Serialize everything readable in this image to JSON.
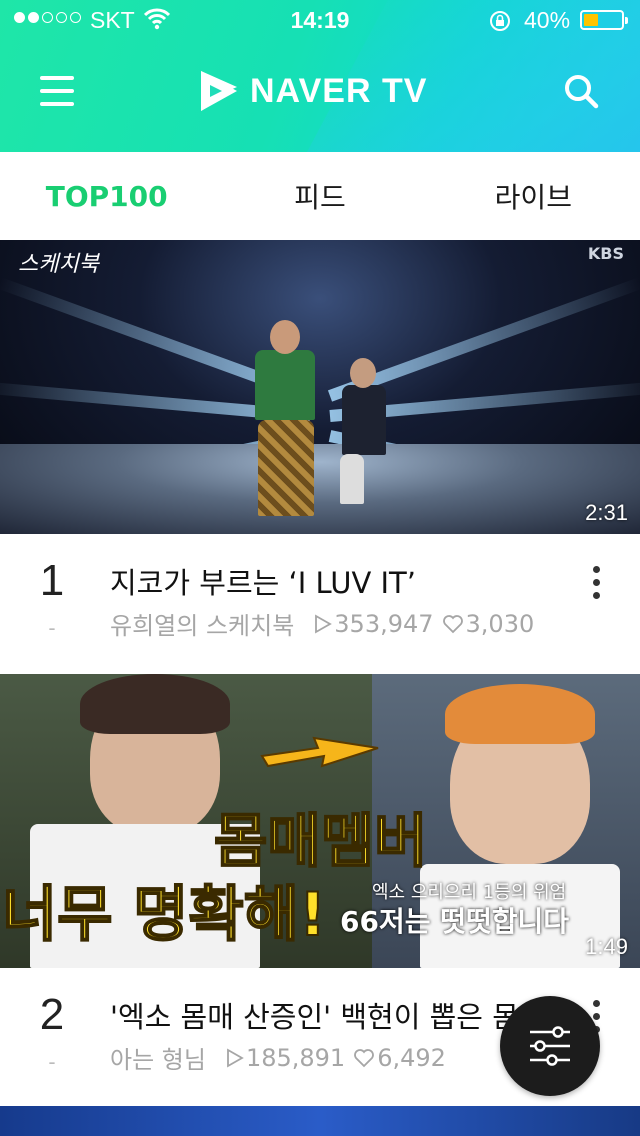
{
  "status_bar": {
    "carrier": "SKT",
    "time": "14:19",
    "battery": "40%",
    "battery_level": 0.4
  },
  "header": {
    "logo_text": "NAVER TV",
    "menu_icon": "hamburger-icon",
    "search_icon": "search-icon"
  },
  "tabs": [
    {
      "label": "TOP100",
      "active": true
    },
    {
      "label": "피드",
      "active": false
    },
    {
      "label": "라이브",
      "active": false
    }
  ],
  "videos": [
    {
      "rank": "1",
      "rank_change": "-",
      "title": "지코가 부르는 ‘I LUV IT’",
      "channel": "유희열의 스케치북",
      "plays": "353,947",
      "likes": "3,030",
      "duration": "2:31",
      "thumb_label": "KBS"
    },
    {
      "rank": "2",
      "rank_change": "-",
      "title": "'엑소 몸매 산증인' 백현이 뽑은 몸매멤버",
      "channel": "아는 형님",
      "plays": "185,891",
      "likes": "6,492",
      "duration": "1:49",
      "caption_1": "몸매멤버",
      "caption_2": "너무 명확해!",
      "caption_3": "엑소 으리으리 1등의 위엄",
      "caption_4": "66저는 떳떳합니다"
    }
  ],
  "fab": {
    "icon": "filter-sliders-icon"
  },
  "colors": {
    "accent_green": "#19ce72",
    "header_gradient_start": "#1fe6a8",
    "header_gradient_end": "#1fd0e2"
  }
}
